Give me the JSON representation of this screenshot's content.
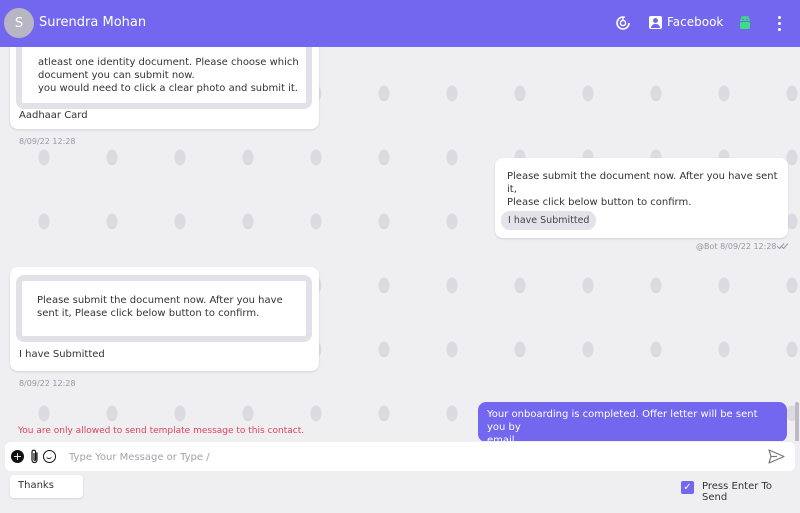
{
  "header": {
    "avatar_initial": "S",
    "contact_name": "Surendra Mohan",
    "channel_label": "Facebook",
    "accent_color": "#7367f0",
    "icons": [
      "refresh-icon",
      "contact-card-icon",
      "android-icon",
      "more-vert-icon"
    ]
  },
  "messages": {
    "m1": {
      "card_line1": "atleast one identity document. Please choose which",
      "card_line2": "document you can submit now.",
      "card_line3": " you would need to click a clear photo and submit it.",
      "reply": "Aadhaar Card",
      "time": "8/09/22 12:28"
    },
    "m2": {
      "line1": "Please submit the document now. After you have sent it,",
      "line2": "Please click below button to confirm.",
      "button": "I have Submitted",
      "meta": "@Bot 8/09/22 12:28"
    },
    "m3": {
      "line1": "Please submit the document now. After you have",
      "line2": "sent it, Please click below button to confirm.",
      "reply": "I have Submitted",
      "time": "8/09/22 12:28"
    },
    "m4": {
      "line1": "Your onboarding is completed. Offer letter will be sent you by",
      "line2": "email"
    }
  },
  "notice": "You are only allowed to send template message to this contact.",
  "composer": {
    "placeholder": "Type Your Message or Type /",
    "quick_reply": "Thanks",
    "enter_to_send_label": "Press Enter To Send",
    "enter_to_send_checked": true
  }
}
